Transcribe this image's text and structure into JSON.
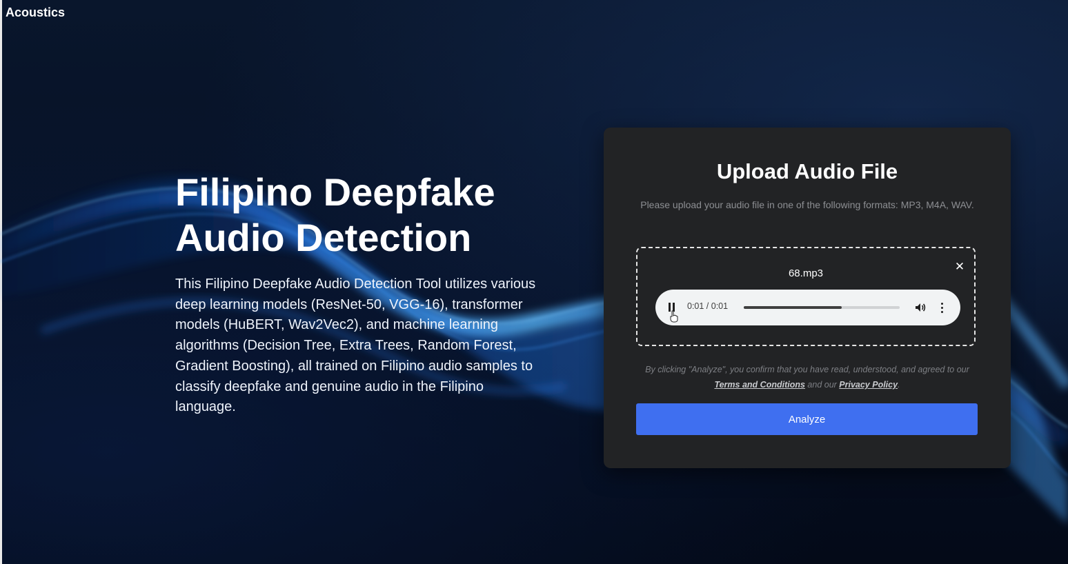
{
  "app": {
    "brand": "Acoustics"
  },
  "hero": {
    "title": "Filipino Deepfake Audio Detection",
    "description": "This Filipino Deepfake Audio Detection Tool utilizes various deep learning models (ResNet-50, VGG-16), transformer models (HuBERT, Wav2Vec2), and machine learning algorithms (Decision Tree, Extra Trees, Random Forest, Gradient Boosting), all trained on Filipino audio samples to classify deepfake and genuine audio in the Filipino language."
  },
  "upload_card": {
    "title": "Upload Audio File",
    "subtitle": "Please upload your audio file in one of the following formats: MP3, M4A, WAV.",
    "file_name": "68.mp3",
    "remove_icon": "close-icon",
    "player": {
      "state": "playing",
      "time_display": "0:01 / 0:01",
      "progress": 0.63,
      "play_icon": "pause-icon",
      "volume_icon": "volume-icon",
      "menu_icon": "more-vertical-icon"
    },
    "consent": {
      "prefix": "By clicking \"Analyze\", you confirm that you have read, understood, and agreed to our ",
      "terms_label": "Terms and Conditions",
      "middle": " and our ",
      "privacy_label": "Privacy Policy",
      "suffix": "."
    },
    "analyze_label": "Analyze"
  },
  "colors": {
    "background": "#050b1c",
    "card": "#222325",
    "accent": "#3f6ff0",
    "wave": "#1e7bff"
  }
}
